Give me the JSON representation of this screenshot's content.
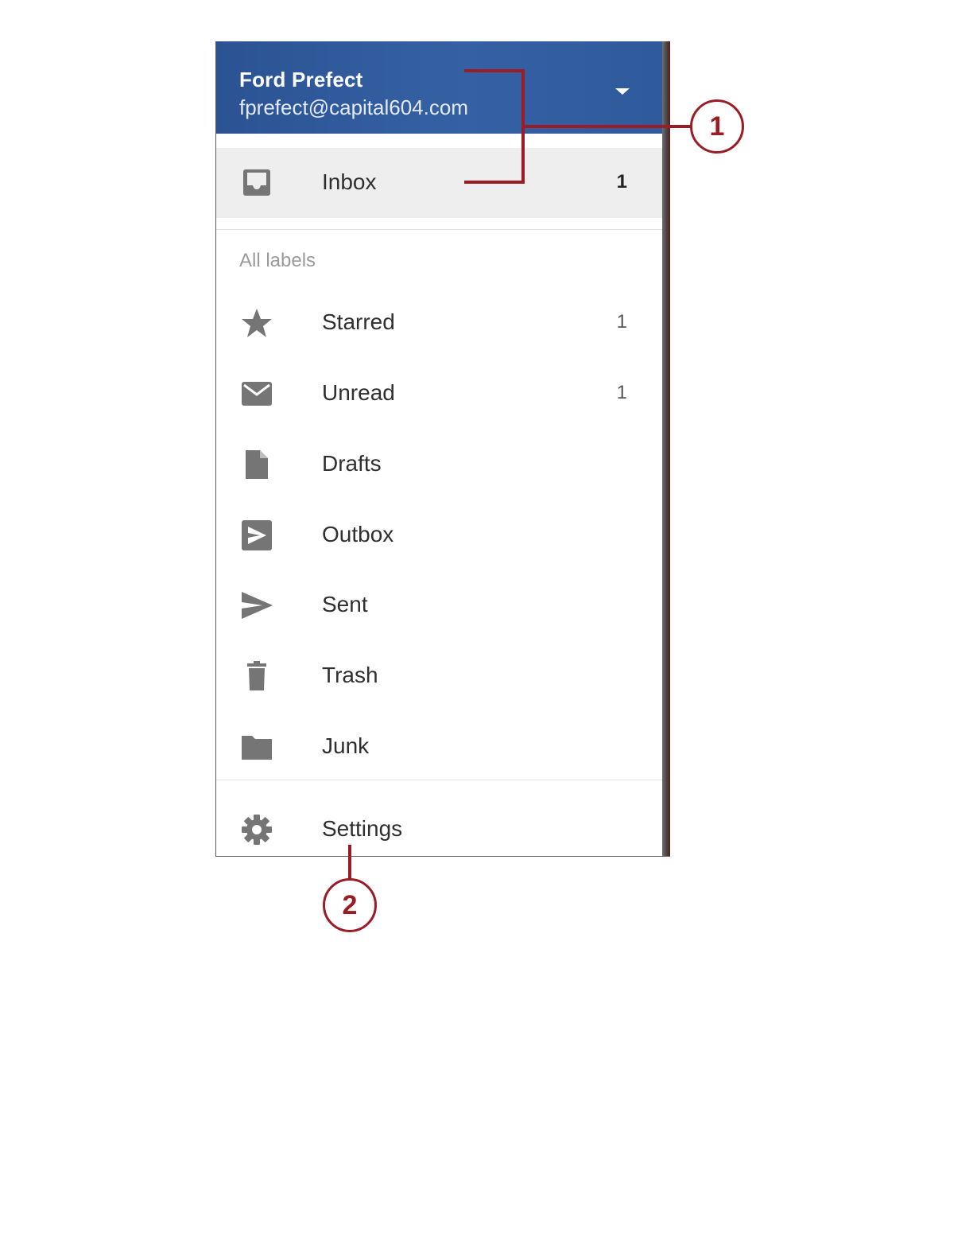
{
  "account": {
    "name": "Ford Prefect",
    "email": "fprefect@capital604.com"
  },
  "inbox": {
    "label": "Inbox",
    "count": "1",
    "icon": "inbox-icon"
  },
  "labels_heading": "All labels",
  "labels": [
    {
      "label": "Starred",
      "count": "1",
      "icon": "star-icon"
    },
    {
      "label": "Unread",
      "count": "1",
      "icon": "mail-icon"
    },
    {
      "label": "Drafts",
      "count": "",
      "icon": "draft-icon"
    },
    {
      "label": "Outbox",
      "count": "",
      "icon": "outbox-icon"
    },
    {
      "label": "Sent",
      "count": "",
      "icon": "send-icon"
    },
    {
      "label": "Trash",
      "count": "",
      "icon": "trash-icon"
    },
    {
      "label": "Junk",
      "count": "",
      "icon": "folder-icon"
    }
  ],
  "settings": {
    "label": "Settings",
    "icon": "gear-icon"
  },
  "callouts": [
    "1",
    "2"
  ],
  "colors": {
    "header": "#3561a4",
    "callout": "#9b1c24",
    "icon": "#757575"
  }
}
